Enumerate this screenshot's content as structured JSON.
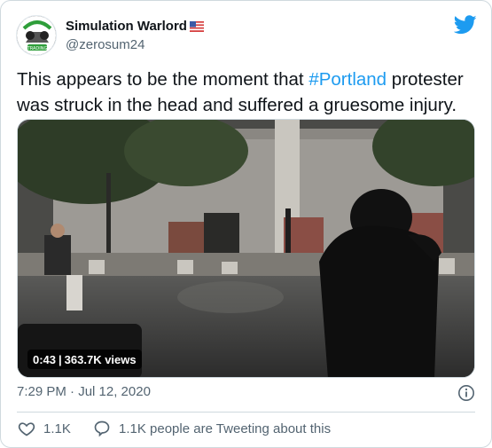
{
  "user": {
    "display_name": "Simulation Warlord",
    "flag_icon": "us-flag-icon",
    "handle": "@zerosum24",
    "avatar_text": "TRADING"
  },
  "brand": {
    "logo": "twitter-bird-icon",
    "color": "#1d9bf0"
  },
  "tweet": {
    "text_before": "This appears to be the moment that ",
    "hashtag": "#Portland",
    "text_after": " protester was struck in the head and suffered a gruesome injury."
  },
  "video": {
    "duration": "0:43",
    "views": "363.7K views"
  },
  "timestamp": "7:29 PM · Jul 12, 2020",
  "actions": {
    "like_count": "1.1K",
    "reply_text": "1.1K people are Tweeting about this"
  },
  "colors": {
    "text": "#0f1419",
    "secondary": "#536471",
    "accent": "#1d9bf0",
    "like_heart": "#536471"
  }
}
